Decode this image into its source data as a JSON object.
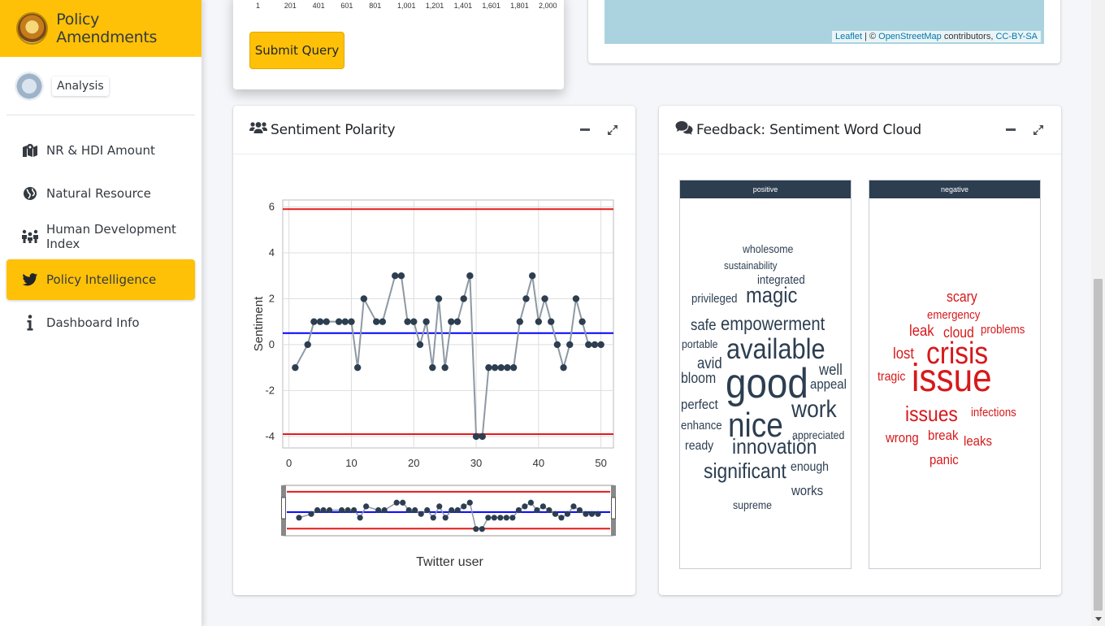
{
  "brand": {
    "title": "Policy Amendments"
  },
  "user": {
    "name": "Analysis"
  },
  "nav": {
    "items": [
      {
        "label": "NR & HDI Amount",
        "icon": "map-marked-icon",
        "active": false
      },
      {
        "label": "Natural Resource",
        "icon": "globe-icon",
        "active": false
      },
      {
        "label": "Human Development Index",
        "icon": "people-icon",
        "active": false
      },
      {
        "label": "Policy Intelligence",
        "icon": "twitter-icon",
        "active": true
      },
      {
        "label": "Dashboard Info",
        "icon": "info-icon",
        "active": false
      }
    ]
  },
  "query_card": {
    "submit_label": "Submit Query",
    "slider_ticks": [
      "1",
      "201",
      "401",
      "601",
      "801",
      "1,001",
      "1,201",
      "1,401",
      "1,601",
      "1,801",
      "2,000"
    ]
  },
  "map_card": {
    "attribution_leaflet": "Leaflet",
    "attribution_sep": " | © ",
    "attribution_osm": "OpenStreetMap",
    "attribution_mid": " contributors, ",
    "attribution_cc": "CC-BY-SA"
  },
  "sentiment_card": {
    "title": "Sentiment Polarity",
    "icon": "users-icon"
  },
  "wordcloud_card": {
    "title": "Feedback: Sentiment Word Cloud",
    "icon": "comments-icon",
    "positive_label": "positive",
    "negative_label": "negative",
    "positive_color": "#2c3e50",
    "negative_color": "#d7191c",
    "positive_words": [
      {
        "w": "wholesome",
        "s": 14
      },
      {
        "w": "sustainability",
        "s": 13
      },
      {
        "w": "integrated",
        "s": 15
      },
      {
        "w": "privileged",
        "s": 15
      },
      {
        "w": "magic",
        "s": 27
      },
      {
        "w": "safe",
        "s": 19
      },
      {
        "w": "empowerment",
        "s": 23
      },
      {
        "w": "portable",
        "s": 14
      },
      {
        "w": "available",
        "s": 35
      },
      {
        "w": "avid",
        "s": 19
      },
      {
        "w": "well",
        "s": 19
      },
      {
        "w": "bloom",
        "s": 18
      },
      {
        "w": "good",
        "s": 52
      },
      {
        "w": "appeal",
        "s": 17
      },
      {
        "w": "perfect",
        "s": 17
      },
      {
        "w": "work",
        "s": 30
      },
      {
        "w": "enhance",
        "s": 15
      },
      {
        "w": "nice",
        "s": 42
      },
      {
        "w": "appreciated",
        "s": 14
      },
      {
        "w": "ready",
        "s": 16
      },
      {
        "w": "innovation",
        "s": 26
      },
      {
        "w": "enough",
        "s": 16
      },
      {
        "w": "significant",
        "s": 26
      },
      {
        "w": "works",
        "s": 17
      },
      {
        "w": "supreme",
        "s": 14
      }
    ],
    "negative_words": [
      {
        "w": "scary",
        "s": 18
      },
      {
        "w": "emergency",
        "s": 15
      },
      {
        "w": "leak",
        "s": 19
      },
      {
        "w": "cloud",
        "s": 18
      },
      {
        "w": "problems",
        "s": 15
      },
      {
        "w": "lost",
        "s": 19
      },
      {
        "w": "crisis",
        "s": 38
      },
      {
        "w": "tragic",
        "s": 16
      },
      {
        "w": "issue",
        "s": 48
      },
      {
        "w": "issues",
        "s": 26
      },
      {
        "w": "infections",
        "s": 15
      },
      {
        "w": "wrong",
        "s": 17
      },
      {
        "w": "break",
        "s": 17
      },
      {
        "w": "leaks",
        "s": 17
      },
      {
        "w": "panic",
        "s": 17
      }
    ]
  },
  "chart_data": {
    "type": "line",
    "title": "",
    "xlabel": "Twitter user",
    "ylabel": "Sentiment",
    "xlim": [
      -1,
      52
    ],
    "ylim": [
      -4.5,
      6.3
    ],
    "x_ticks": [
      0,
      10,
      20,
      30,
      40,
      50
    ],
    "y_ticks": [
      -4,
      -2,
      0,
      2,
      4,
      6
    ],
    "grid": true,
    "series": [
      {
        "x": [
          1,
          3,
          4,
          5,
          6,
          8,
          9,
          10,
          11,
          12,
          14,
          15,
          17,
          18,
          19,
          20,
          21,
          22,
          23,
          24,
          25,
          26,
          27,
          28,
          29,
          30,
          31,
          32,
          33,
          34,
          35,
          36,
          37,
          38,
          39,
          40,
          41,
          42,
          43,
          44,
          45,
          46,
          47,
          48,
          49,
          50
        ],
        "y": [
          -1,
          0,
          1,
          1,
          1,
          1,
          1,
          1,
          -1,
          2,
          1,
          1,
          3,
          3,
          1,
          1,
          0,
          1,
          -1,
          2,
          -1,
          1,
          1,
          2,
          3,
          -4,
          -4,
          -1,
          -1,
          -1,
          -1,
          -1,
          1,
          2,
          3,
          1,
          2,
          1,
          0,
          -1,
          0,
          2,
          1,
          0,
          0,
          0
        ]
      }
    ],
    "reference_lines": [
      {
        "value": 5.9,
        "color": "#e41a1c"
      },
      {
        "value": 0.5,
        "color": "#0000ff"
      },
      {
        "value": -3.9,
        "color": "#e41a1c"
      }
    ]
  }
}
